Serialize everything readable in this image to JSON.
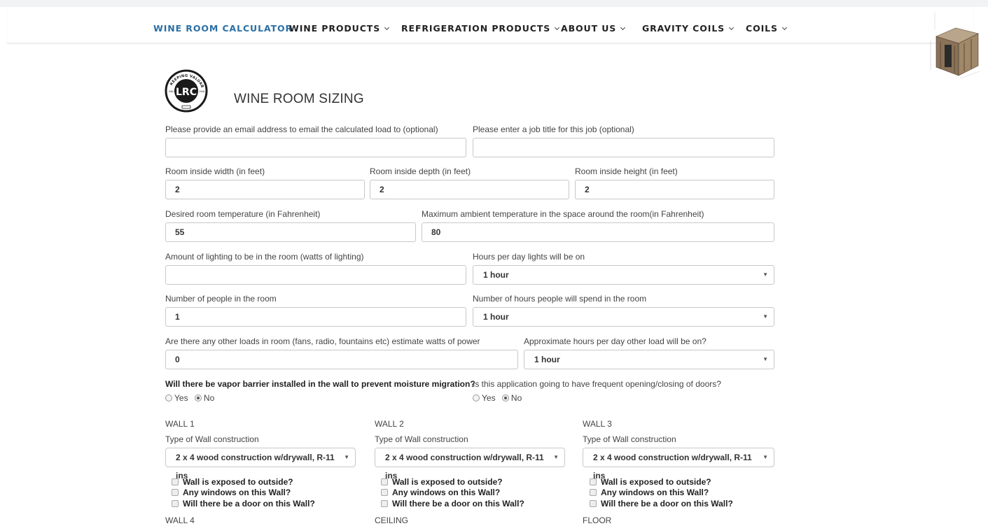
{
  "nav": {
    "items": [
      {
        "label": "WINE ROOM CALCULATOR",
        "active": true
      },
      {
        "label": "WINE PRODUCTS",
        "dropdown": true
      },
      {
        "label": "REFRIGERATION PRODUCTS",
        "dropdown": true
      },
      {
        "label": "ABOUT US",
        "dropdown": true
      },
      {
        "label": "GRAVITY COILS",
        "dropdown": true
      },
      {
        "label": "COILS",
        "dropdown": true
      }
    ]
  },
  "logo": {
    "initials": "LRC",
    "tagline": "KEEPING VALUABLES COLD",
    "since": "SINCE",
    "year": "1946"
  },
  "page_title": "WINE ROOM SIZING",
  "form": {
    "email_label": "Please provide an email address to email the calculated load to (optional)",
    "email_value": "",
    "job_label": "Please enter a job title for this job (optional)",
    "job_value": "",
    "width_label": "Room inside width (in feet)",
    "width_value": "2",
    "depth_label": "Room inside depth (in feet)",
    "depth_value": "2",
    "height_label": "Room inside height (in feet)",
    "height_value": "2",
    "temp_label": "Desired room temperature (in Fahrenheit)",
    "temp_value": "55",
    "ambient_label": "Maximum ambient temperature in the space around the room(in Fahrenheit)",
    "ambient_value": "80",
    "lighting_label": "Amount of lighting to be in the room (watts of lighting)",
    "lighting_value": "",
    "light_hours_label": "Hours per day lights will be on",
    "light_hours_value": "1 hour",
    "people_label": "Number of people in the room",
    "people_value": "1",
    "people_hours_label": "Number of hours people will spend in the room",
    "people_hours_value": "1 hour",
    "other_loads_label": "Are there any other loads in room (fans, radio, fountains etc) estimate watts of power",
    "other_loads_value": "0",
    "other_hours_label": "Approximate hours per day other load will be on?",
    "other_hours_value": "1 hour",
    "vapor_label": "Will there be vapor barrier installed in the wall to prevent moisture migration?",
    "vapor_yes": "Yes",
    "vapor_no": "No",
    "vapor_selected": "No",
    "doors_label": "Is this application going to have frequent opening/closing of doors?",
    "doors_yes": "Yes",
    "doors_no": "No",
    "doors_selected": "No"
  },
  "walls": [
    {
      "title": "WALL 1",
      "type_label": "Type of Wall construction",
      "type_value": "2 x 4 wood construction w/drywall, R-11 ins",
      "checks": [
        "Wall is exposed to outside?",
        "Any windows on this Wall?",
        "Will there be a door on this Wall?"
      ]
    },
    {
      "title": "WALL 2",
      "type_label": "Type of Wall construction",
      "type_value": "2 x 4 wood construction w/drywall, R-11 ins",
      "checks": [
        "Wall is exposed to outside?",
        "Any windows on this Wall?",
        "Will there be a door on this Wall?"
      ]
    },
    {
      "title": "WALL 3",
      "type_label": "Type of Wall construction",
      "type_value": "2 x 4 wood construction w/drywall, R-11 ins",
      "checks": [
        "Wall is exposed to outside?",
        "Any windows on this Wall?",
        "Will there be a door on this Wall?"
      ]
    }
  ],
  "bottom_sections": [
    "WALL 4",
    "CEILING",
    "FLOOR"
  ],
  "colors": {
    "accent": "#2a6fa5",
    "logo": "#1a1a1a"
  }
}
